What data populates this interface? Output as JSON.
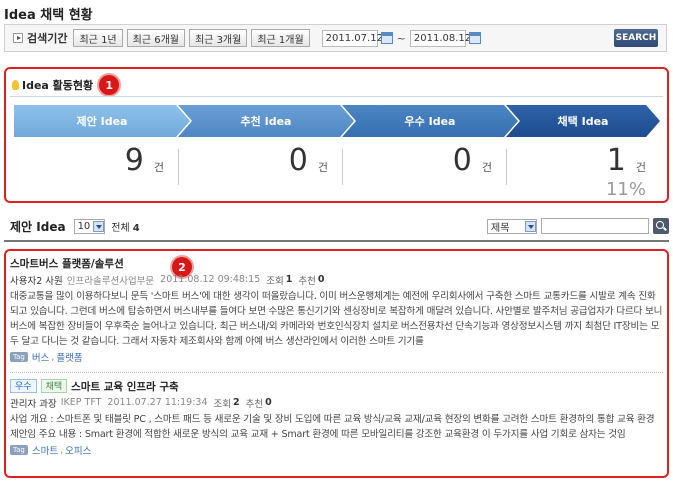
{
  "page": {
    "title": "Idea 채택 현황"
  },
  "search": {
    "period_label": "검색기간",
    "quick_buttons": [
      "최근 1년",
      "최근 6개월",
      "최근 3개월",
      "최근 1개월"
    ],
    "date_from": "2011.07.12",
    "date_sep": "~",
    "date_to": "2011.08.12",
    "search_button": "SEARCH"
  },
  "activity": {
    "title": "Idea 활동현황",
    "badge": "1",
    "stages": [
      {
        "label": "제안 Idea",
        "count": "9",
        "unit": "건"
      },
      {
        "label": "추천 Idea",
        "count": "0",
        "unit": "건"
      },
      {
        "label": "우수 Idea",
        "count": "0",
        "unit": "건"
      },
      {
        "label": "채택 Idea",
        "count": "1",
        "unit": "건",
        "percent": "11%"
      }
    ]
  },
  "list": {
    "title": "제안 Idea",
    "page_size": "10",
    "total_label": "전체",
    "total_count": "4",
    "search_field_option": "제목",
    "badge": "2",
    "items": [
      {
        "title": "스마트버스 플랫폼/솔루션",
        "badges": [],
        "author": "사용자2 사원",
        "dept": "인프라솔루션사업부문",
        "date": "2011.08.12 09:48:15",
        "views_label": "조회",
        "views": "1",
        "recommend_label": "추천",
        "recommend": "0",
        "body": "대중교통을 많이 이용하다보니 문득 '스마트 버스'에 대한 생각이 떠올랐습니다. 이미 버스운행체계는 예전에 우리회사에서 구축한 스마트 교통카드를 시발로 계속 진화되고 있습니다. 그런데 버스에 탑승하면서 버스내부를 들여다 보면 수많은 통신기기와 센싱장비로 복잡하게 매달려 있습니다. 사안별로 발주처님 공급업자가 다르다 보니 버스에 복잡한 장비들이 우후죽순 늘어나고 있습니다. 최근 버스내/외 카메라와 번호인식장치 설치로 버스전용차선 단속기능과 영상정보시스템 까지 최첨단 IT장비는 모두 달고 다니는 것 같습니다. 그래서 자동차 제조회사와 함께 아예 버스 생산라인에서 이러한 스마트 기기를",
        "tags": [
          "버스",
          "플랫폼"
        ]
      },
      {
        "title": "스마트 교육 인프라 구축",
        "badges": [
          "우수",
          "채택"
        ],
        "author": "관리자 과장",
        "dept": "IKEP TFT",
        "date": "2011.07.27 11:19:34",
        "views_label": "조회",
        "views": "2",
        "recommend_label": "추천",
        "recommend": "0",
        "body": "사업 개요 : 스마트폰 및 태블릿 PC , 스마트 패드 등 새로운 기술 및 장비 도입에 따른 교육 방식/교육 교재/교육 현장의 변화를 고려한 스마트 환경하의 통합 교육 환경 제안임 주요 내용 : Smart 환경에 적합한 새로운 방식의 교육 교재 + Smart 환경에 따른 모바일리티를 강조한 교육환경 이 두가지를 사업 기회로 삼자는 것임",
        "tags": [
          "스마트",
          "오피스"
        ]
      }
    ]
  }
}
